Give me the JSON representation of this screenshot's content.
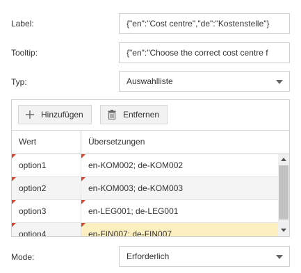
{
  "form": {
    "label_label": "Label:",
    "label_value": "{\"en\":\"Cost centre\",\"de\":\"Kostenstelle\"}",
    "tooltip_label": "Tooltip:",
    "tooltip_value": "{\"en\":\"Choose the correct cost centre f",
    "type_label": "Typ:",
    "type_value": "Auswahlliste",
    "mode_label": "Mode:",
    "mode_value": "Erforderlich"
  },
  "grid": {
    "add_label": "Hinzufügen",
    "remove_label": "Entfernen",
    "columns": [
      "Wert",
      "Übersetzungen"
    ],
    "rows": [
      {
        "value": "option1",
        "translations": "en-KOM002; de-KOM002"
      },
      {
        "value": "option2",
        "translations": "en-KOM003; de-KOM003"
      },
      {
        "value": "option3",
        "translations": "en-LEG001; de-LEG001"
      },
      {
        "value": "option4",
        "translations": "en-FIN007; de-FIN007"
      }
    ]
  },
  "colors": {
    "row_alt": "#f4f4f4",
    "row_selected_cell": "#fdf0c0",
    "dirty_marker": "#d9452c"
  },
  "icons": {
    "add": "plus-icon",
    "remove": "trash-icon",
    "dropdown": "chevron-down-icon"
  }
}
